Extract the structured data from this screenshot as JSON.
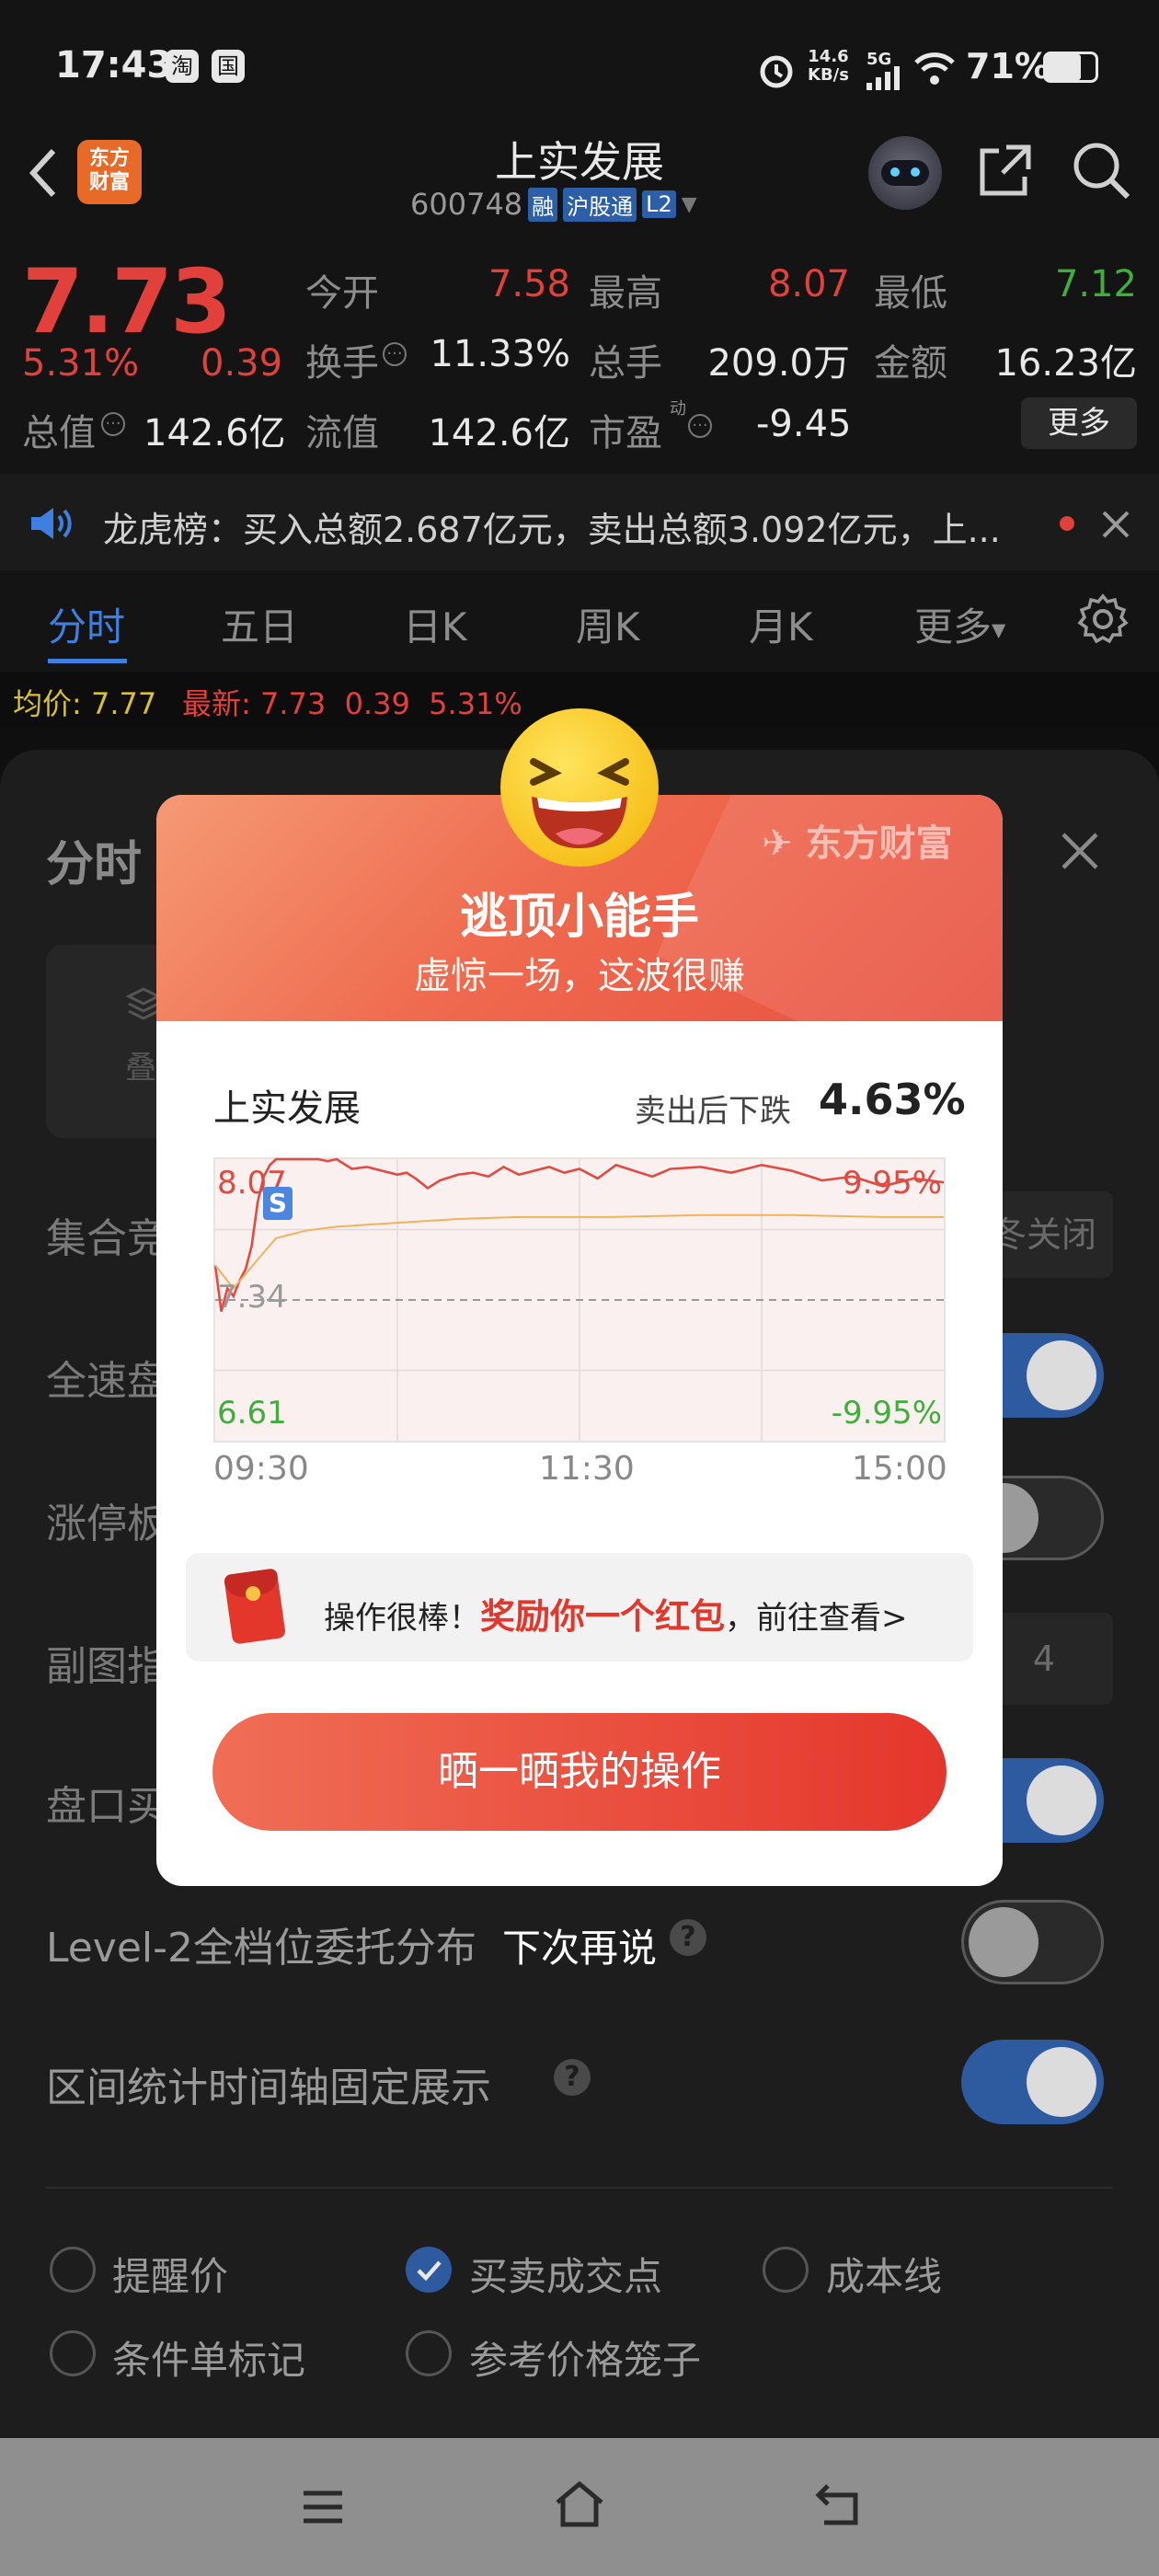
{
  "status_bar": {
    "time": "17:43",
    "app_badge_1": "淘",
    "app_badge_2": "国",
    "net_speed_value": "14.6",
    "net_speed_unit": "KB/s",
    "signal_type": "5G",
    "battery_pct": "71%",
    "battery_level": 0.71
  },
  "header": {
    "logo_line1": "东方",
    "logo_line2": "财富",
    "stock_name": "上实发展",
    "stock_code": "600748",
    "tag_rong": "融",
    "tag_hgt": "沪股通",
    "tag_l2": "L2"
  },
  "quote": {
    "price": "7.73",
    "change_pct": "5.31%",
    "change_amt": "0.39",
    "rows": [
      [
        {
          "label": "今开",
          "value": "7.58",
          "color": "red"
        },
        {
          "label": "最高",
          "value": "8.07",
          "color": "red"
        },
        {
          "label": "最低",
          "value": "7.12",
          "color": "green"
        }
      ],
      [
        {
          "label": "换手",
          "value": "11.33%",
          "color": "white"
        },
        {
          "label": "总手",
          "value": "209.0万",
          "color": "white"
        },
        {
          "label": "金额",
          "value": "16.23亿",
          "color": "white"
        }
      ]
    ],
    "total_value_label": "总值",
    "total_value": "142.6亿",
    "float_value_label": "流值",
    "float_value": "142.6亿",
    "pe_label": "市盈",
    "pe_sup": "动",
    "pe_value": "-9.45",
    "more_button": "更多"
  },
  "notice": {
    "text": "龙虎榜：买入总额2.687亿元，卖出总额3.092亿元，上..."
  },
  "tabs": {
    "items": [
      "分时",
      "五日",
      "日K",
      "周K",
      "月K"
    ],
    "more": "更多",
    "active_index": 0
  },
  "chart_strip": {
    "avg_label": "均价:",
    "avg_value": "7.77",
    "latest_label": "最新:",
    "latest_value": "7.73",
    "latest_change": "0.39",
    "latest_pct": "5.31%"
  },
  "settings_sheet": {
    "title_partial": "分时",
    "tile_partial": "叠",
    "rows": [
      {
        "label": "集合竞",
        "control": "chip",
        "chip_text": "冬关闭"
      },
      {
        "label": "全速盘",
        "control": "toggle",
        "on": true
      },
      {
        "label": "涨停板",
        "control": "toggle",
        "on": false
      },
      {
        "label": "副图指",
        "control": "chip",
        "chip_text": "4"
      },
      {
        "label": "盘口买",
        "control": "toggle",
        "on": true
      },
      {
        "label": "Level-2全档位委托分布",
        "control": "toggle",
        "on": false
      },
      {
        "label": "区间统计时间轴固定展示",
        "control": "toggle",
        "on": true
      }
    ],
    "checkboxes": [
      {
        "label": "提醒价",
        "checked": false
      },
      {
        "label": "买卖成交点",
        "checked": true
      },
      {
        "label": "成本线",
        "checked": false
      },
      {
        "label": "条件单标记",
        "checked": false
      },
      {
        "label": "参考价格笼子",
        "checked": false
      }
    ]
  },
  "modal": {
    "brand": "东方财富",
    "title": "逃顶小能手",
    "subtitle": "虚惊一场，这波很赚",
    "stock_name": "上实发展",
    "result_label": "卖出后下跌",
    "result_value": "4.63%",
    "sell_marker": "S",
    "reward_prefix": "操作很棒！",
    "reward_highlight": "奖励你一个红包",
    "reward_suffix": "，前往查看>",
    "cta": "晒一晒我的操作",
    "dismiss": "下次再说"
  },
  "chart_data": {
    "type": "line",
    "x_ticks": [
      "09:30",
      "11:30",
      "15:00"
    ],
    "y_max_label": "8.07",
    "y_mid_label": "7.34",
    "y_min_label": "6.61",
    "pct_max_label": "9.95%",
    "pct_min_label": "-9.95%",
    "ylim": [
      6.61,
      8.07
    ],
    "reference_price": 7.34,
    "series": [
      {
        "x": [
          0,
          2,
          4,
          6,
          8,
          10,
          12,
          14,
          16,
          18,
          20,
          22,
          25,
          28,
          31,
          34,
          37,
          40,
          45,
          50,
          55,
          60,
          63,
          66,
          70,
          74,
          80,
          85,
          90,
          95,
          100,
          105,
          110,
          115,
          120,
          126,
          132,
          138,
          144,
          150,
          160,
          170,
          180,
          190,
          200,
          210,
          220,
          230,
          240
        ],
        "values": [
          7.52,
          7.28,
          7.4,
          7.36,
          7.44,
          7.5,
          7.62,
          7.85,
          7.98,
          8.04,
          8.07,
          8.07,
          8.07,
          8.07,
          8.07,
          8.07,
          8.06,
          8.07,
          8.02,
          8.03,
          8.01,
          7.99,
          8.0,
          7.97,
          7.92,
          7.96,
          7.99,
          8.0,
          7.98,
          8.03,
          7.99,
          8.01,
          8.03,
          8.0,
          8.02,
          7.97,
          8.04,
          8.01,
          7.98,
          8.02,
          8.03,
          8.0,
          8.04,
          8.01,
          7.96,
          7.98,
          7.93,
          7.97,
          7.95
        ],
        "color": "#e54a3f"
      },
      {
        "x": [
          0,
          6,
          14,
          20,
          30,
          40,
          60,
          80,
          100,
          130,
          160,
          190,
          220,
          240
        ],
        "values": [
          7.52,
          7.4,
          7.55,
          7.66,
          7.7,
          7.72,
          7.74,
          7.76,
          7.77,
          7.77,
          7.78,
          7.78,
          7.77,
          7.77
        ],
        "color": "#f0b25a"
      }
    ]
  }
}
